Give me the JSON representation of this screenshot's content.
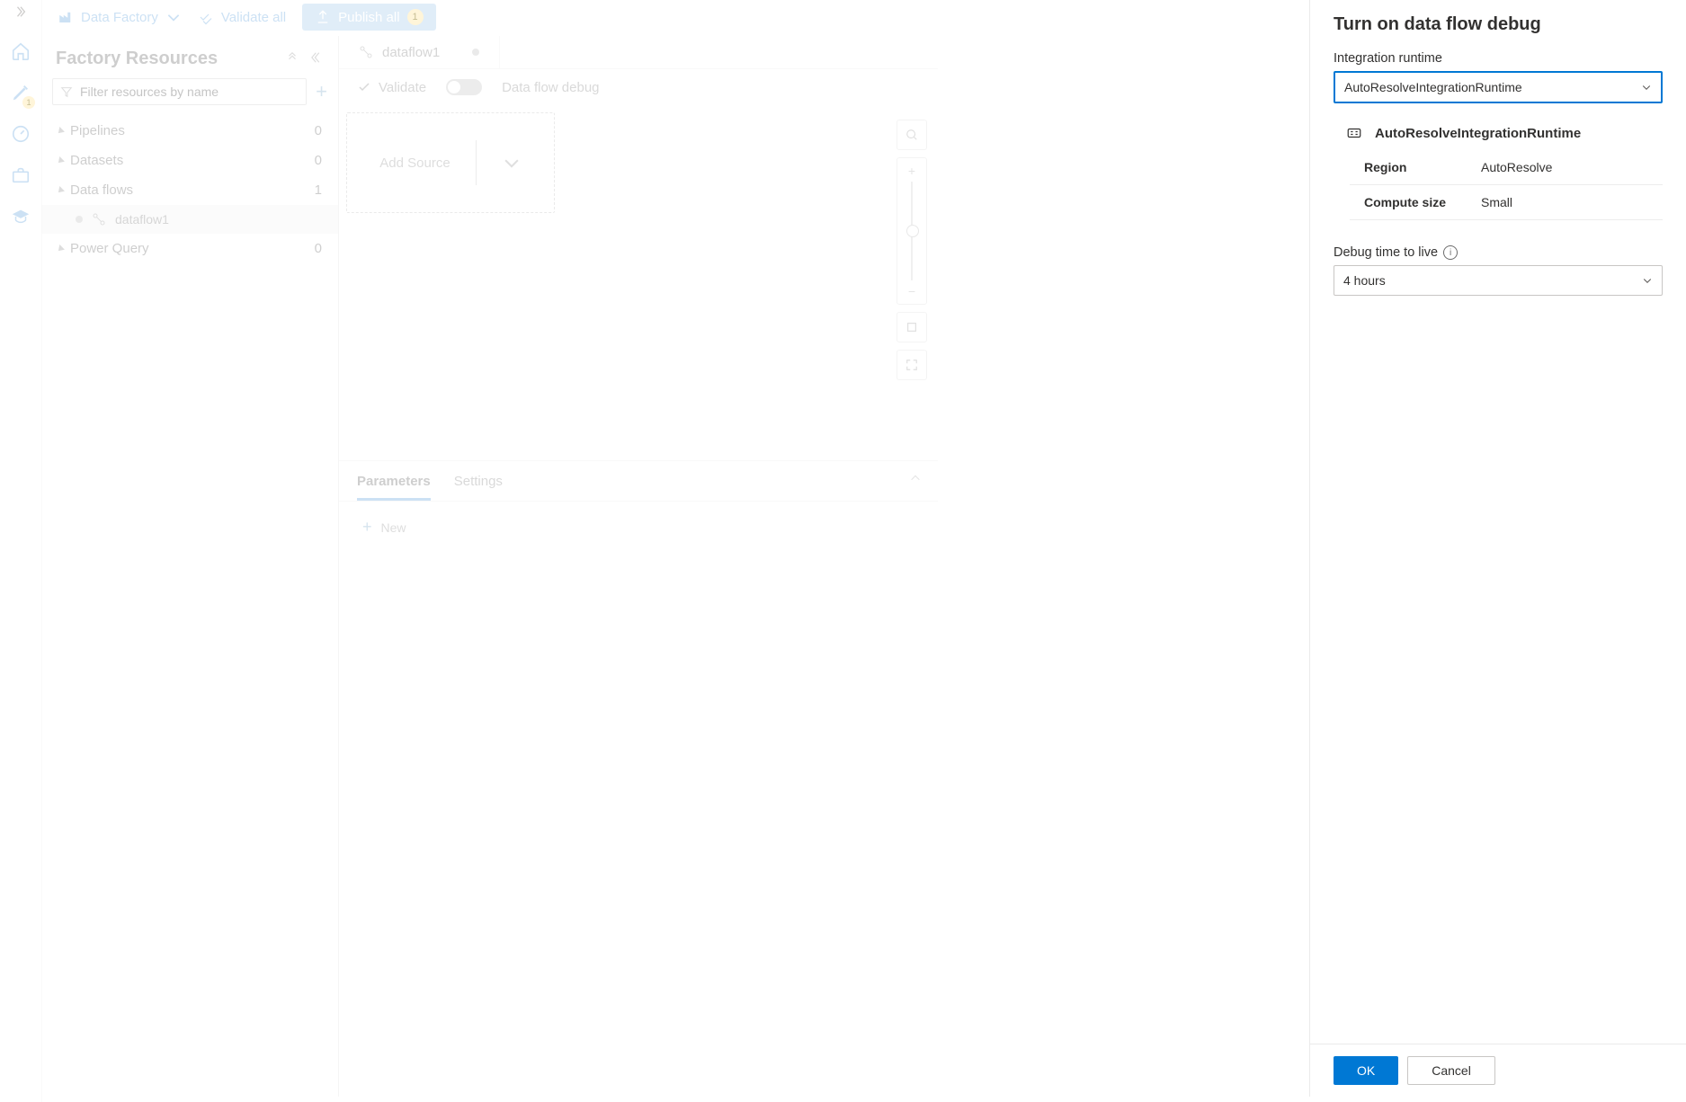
{
  "rail": {
    "pencil_badge": "1"
  },
  "toolbar": {
    "factory_label": "Data Factory",
    "validate_all": "Validate all",
    "publish_all": "Publish all",
    "publish_count": "1"
  },
  "resources": {
    "title": "Factory Resources",
    "filter_placeholder": "Filter resources by name",
    "sections": [
      {
        "label": "Pipelines",
        "count": "0"
      },
      {
        "label": "Datasets",
        "count": "0"
      },
      {
        "label": "Data flows",
        "count": "1"
      },
      {
        "label": "Power Query",
        "count": "0"
      }
    ],
    "dataflow_child": "dataflow1"
  },
  "editor": {
    "tab_label": "dataflow1",
    "validate": "Validate",
    "debug_label": "Data flow debug",
    "add_source": "Add Source",
    "param_tab": "Parameters",
    "settings_tab": "Settings",
    "new_label": "New"
  },
  "panel": {
    "title": "Turn on data flow debug",
    "ir_label": "Integration runtime",
    "ir_value": "AutoResolveIntegrationRuntime",
    "ir_name": "AutoResolveIntegrationRuntime",
    "region_key": "Region",
    "region_val": "AutoResolve",
    "size_key": "Compute size",
    "size_val": "Small",
    "ttl_label": "Debug time to live",
    "ttl_value": "4 hours",
    "ok": "OK",
    "cancel": "Cancel"
  }
}
